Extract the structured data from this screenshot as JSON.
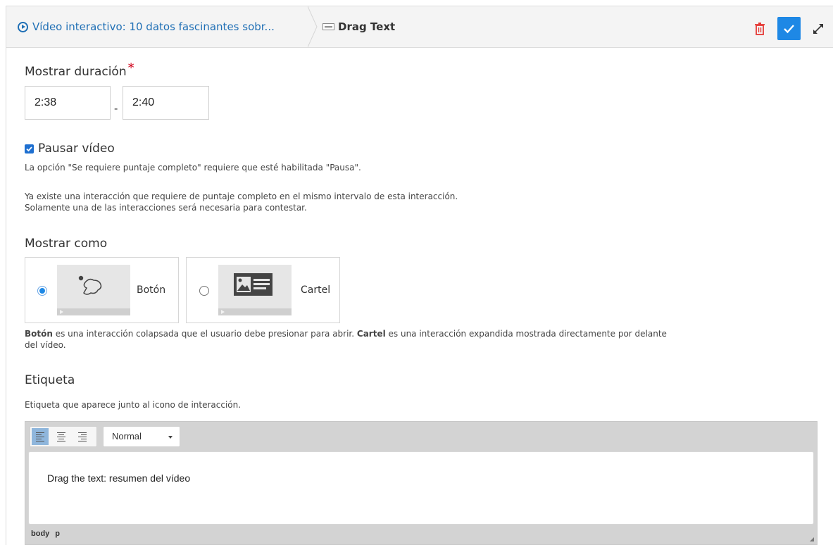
{
  "header": {
    "crumb_parent": "Vídeo interactivo: 10 datos fascinantes sobr...",
    "crumb_current": "Drag Text",
    "icons": [
      "play-circle-icon",
      "drag-text-icon",
      "trash-icon",
      "check-icon",
      "expand-icon"
    ],
    "colors": {
      "link": "#1f6fb5",
      "accent": "#1e88e5",
      "danger": "#e53935"
    }
  },
  "duration": {
    "label": "Mostrar duración",
    "required_mark": "*",
    "start": "2:38",
    "separator": "-",
    "end": "2:40"
  },
  "pause": {
    "label": "Pausar vídeo",
    "checked": true,
    "note": "La opción \"Se requiere puntaje completo\" requiere que esté habilitada \"Pausa\".",
    "warning_line1": "Ya existe una interacción que requiere de puntaje completo en el mismo intervalo de esta interacción.",
    "warning_line2": "Solamente una de las interacciones será necesaria para contestar."
  },
  "display_as": {
    "label": "Mostrar como",
    "options": [
      {
        "label": "Botón",
        "selected": true
      },
      {
        "label": "Cartel",
        "selected": false
      }
    ],
    "desc_bold1": "Botón",
    "desc_text1": " es una interacción colapsada que el usuario debe presionar para abrir. ",
    "desc_bold2": "Cartel",
    "desc_text2": " es una interacción expandida mostrada directamente por delante",
    "desc_text3": "del vídeo."
  },
  "label_field": {
    "label": "Etiqueta",
    "help": "Etiqueta que aparece junto al icono de interacción.",
    "format": "Normal",
    "content": "Drag the text: resumen del vídeo",
    "path": [
      "body",
      "p"
    ]
  }
}
